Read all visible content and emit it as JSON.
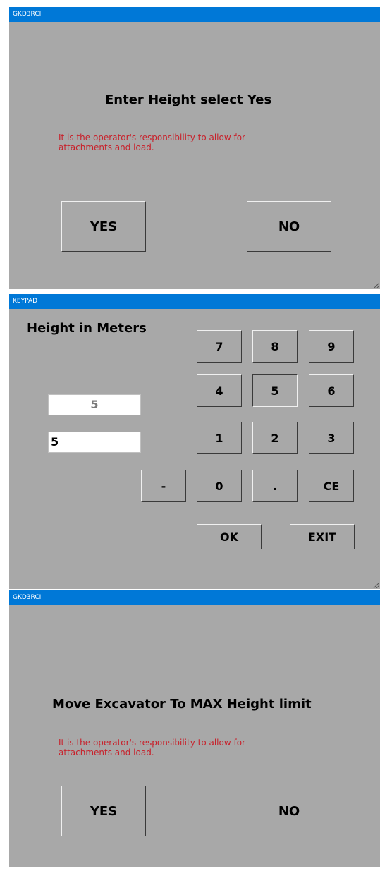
{
  "dialog_top": {
    "title": "GKD3RCI",
    "heading": "Enter Height select Yes",
    "warning": "It is the operator's responsibility to allow for attachments and load.",
    "yes_label": "YES",
    "no_label": "NO"
  },
  "keypad": {
    "title": "KEYPAD",
    "heading": "Height in Meters",
    "display_value": "5",
    "entry_value": "5",
    "keys": {
      "k7": "7",
      "k8": "8",
      "k9": "9",
      "k4": "4",
      "k5": "5",
      "k6": "6",
      "k1": "1",
      "k2": "2",
      "k3": "3",
      "minus": "-",
      "k0": "0",
      "dot": ".",
      "ce": "CE"
    },
    "ok_label": "OK",
    "exit_label": "EXIT"
  },
  "dialog_bottom": {
    "title": "GKD3RCI",
    "heading": "Move Excavator To MAX Height limit",
    "warning": "It is the operator's responsibility to allow for attachments and load.",
    "yes_label": "YES",
    "no_label": "NO"
  },
  "colors": {
    "titlebar": "#0078d7",
    "window_bg": "#a8a8a8",
    "warning_text": "#c8202a"
  }
}
